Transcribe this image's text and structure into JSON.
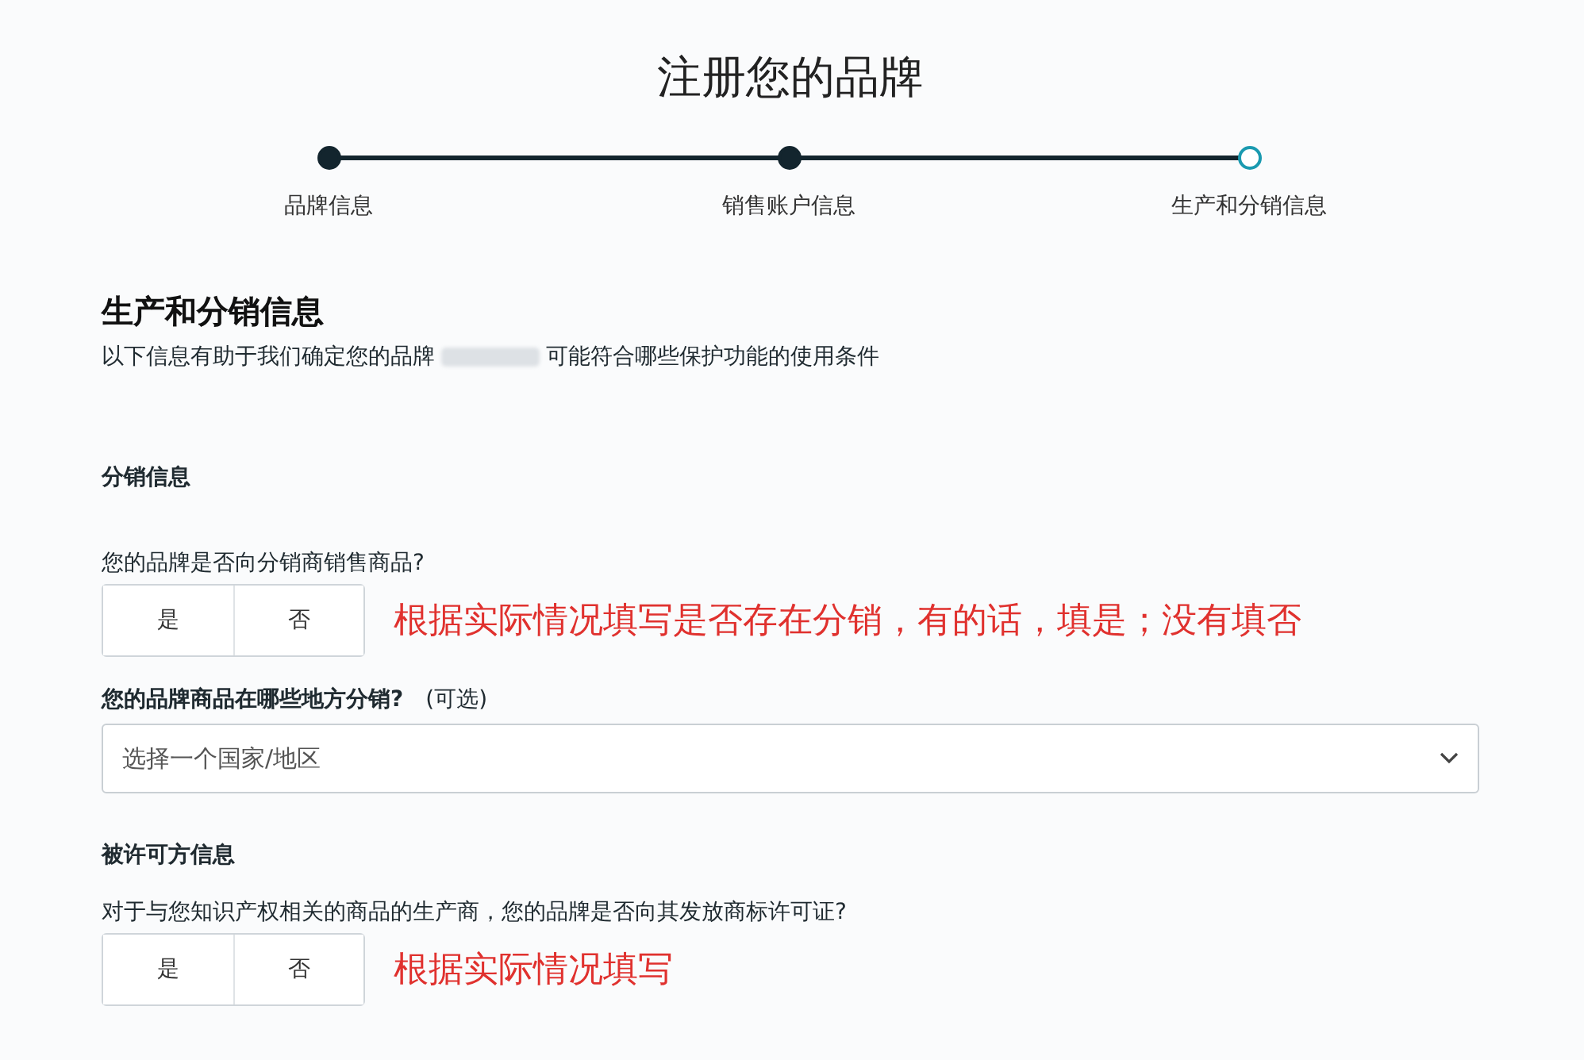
{
  "page_title": "注册您的品牌",
  "steps": [
    {
      "label": "品牌信息",
      "completed": true,
      "current": false
    },
    {
      "label": "销售账户信息",
      "completed": true,
      "current": false
    },
    {
      "label": "生产和分销信息",
      "completed": false,
      "current": true
    }
  ],
  "section": {
    "heading": "生产和分销信息",
    "intro_before": "以下信息有助于我们确定您的品牌",
    "intro_redacted": true,
    "intro_after": "可能符合哪些保护功能的使用条件"
  },
  "distribution": {
    "heading": "分销信息",
    "question": "您的品牌是否向分销商销售商品?",
    "options": [
      {
        "label": "是",
        "selected": false
      },
      {
        "label": "否",
        "selected": false
      }
    ],
    "annotation": "根据实际情况填写是否存在分销，有的话，填是；没有填否",
    "where_label": "您的品牌商品在哪些地方分销?",
    "where_optional": "(可选)",
    "select": {
      "placeholder": "选择一个国家/地区"
    }
  },
  "licensee": {
    "heading": "被许可方信息",
    "question": "对于与您知识产权相关的商品的生产商，您的品牌是否向其发放商标许可证?",
    "options": [
      {
        "label": "是",
        "selected": false
      },
      {
        "label": "否",
        "selected": false
      }
    ],
    "annotation": "根据实际情况填写"
  }
}
